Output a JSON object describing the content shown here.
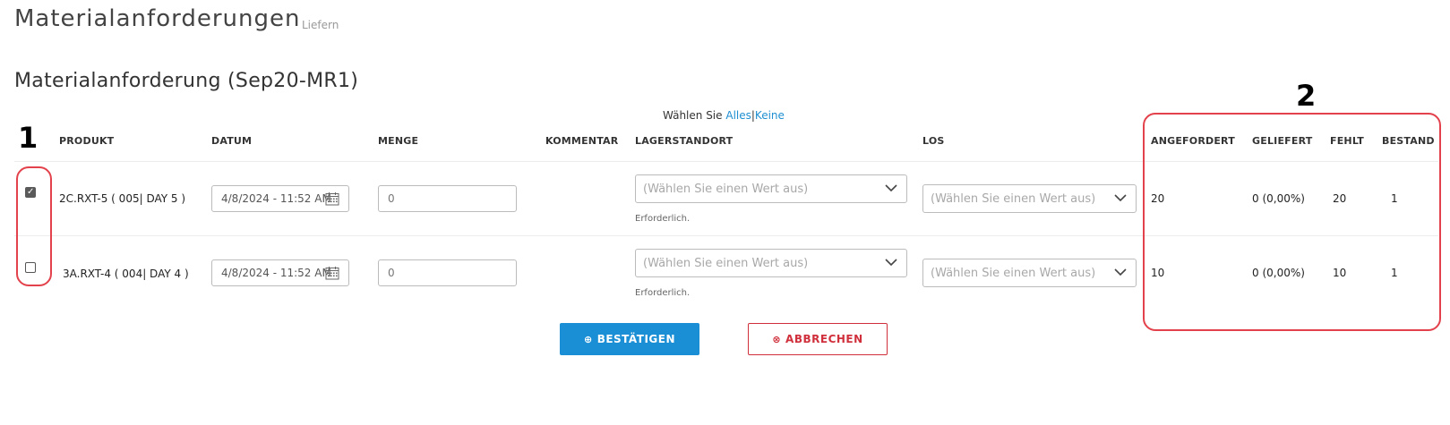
{
  "header": {
    "title": "Materialanforderungen",
    "subtitle": "Liefern"
  },
  "section": {
    "title": "Materialanforderung (Sep20-MR1)"
  },
  "selection": {
    "prefix": "Wählen Sie",
    "all": "Alles",
    "separator": "|",
    "none": "Keine"
  },
  "columns": {
    "produkt": "PRODUKT",
    "datum": "DATUM",
    "menge": "MENGE",
    "kommentar": "KOMMENTAR",
    "lagerstandort": "LAGERSTANDORT",
    "los": "LOS",
    "angefordert": "ANGEFORDERT",
    "geliefert": "GELIEFERT",
    "fehlt": "FEHLT",
    "bestand": "BESTAND"
  },
  "rows": [
    {
      "checked": true,
      "product": "2C.RXT-5 ( 005| DAY 5 )",
      "date": "4/8/2024 - 11:52 AM",
      "quantity": "0",
      "location_placeholder": "(Wählen Sie einen Wert aus)",
      "location_note": "Erforderlich.",
      "lot_placeholder": "(Wählen Sie einen Wert aus)",
      "requested": "20",
      "delivered": "0 (0,00%)",
      "missing": "20",
      "stock": "1"
    },
    {
      "checked": false,
      "product": "3A.RXT-4 ( 004| DAY 4 )",
      "date": "4/8/2024 - 11:52 AM",
      "quantity": "0",
      "location_placeholder": "(Wählen Sie einen Wert aus)",
      "location_note": "Erforderlich.",
      "lot_placeholder": "(Wählen Sie einen Wert aus)",
      "requested": "10",
      "delivered": "0 (0,00%)",
      "missing": "10",
      "stock": "1"
    }
  ],
  "buttons": {
    "confirm_icon": "⊕",
    "confirm": "BESTÄTIGEN",
    "cancel_icon": "⊗",
    "cancel": "ABBRECHEN"
  },
  "annotations": {
    "label_1": "1",
    "label_2": "2",
    "color": "#e3414b"
  },
  "icons": {
    "date": "calendar-icon",
    "select": "chevron-down-icon",
    "confirm": "plus-circle-icon",
    "cancel": "x-circle-icon"
  }
}
